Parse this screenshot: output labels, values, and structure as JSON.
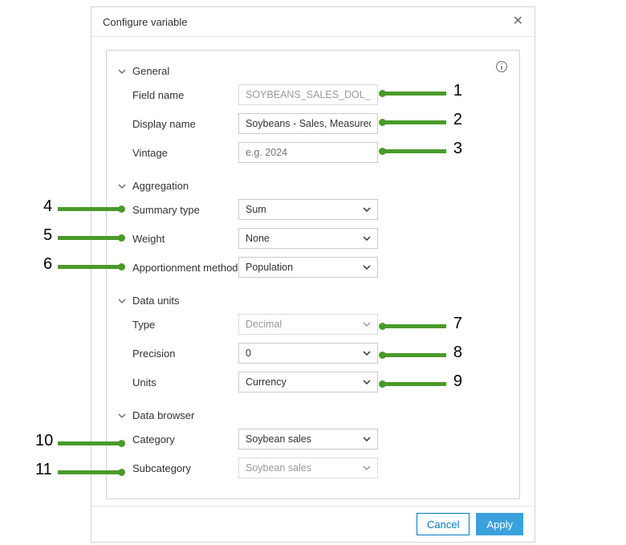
{
  "dialog": {
    "title": "Configure variable"
  },
  "sections": {
    "general": {
      "header": "General",
      "field_name_label": "Field name",
      "field_name_value": "SOYBEANS_SALES_DOL_TO",
      "display_name_label": "Display name",
      "display_name_value": "Soybeans - Sales, Measured i",
      "vintage_label": "Vintage",
      "vintage_placeholder": "e.g. 2024"
    },
    "aggregation": {
      "header": "Aggregation",
      "summary_label": "Summary type",
      "summary_value": "Sum",
      "weight_label": "Weight",
      "weight_value": "None",
      "apportion_label": "Apportionment method",
      "apportion_value": "Population"
    },
    "data_units": {
      "header": "Data units",
      "type_label": "Type",
      "type_value": "Decimal",
      "precision_label": "Precision",
      "precision_value": "0",
      "units_label": "Units",
      "units_value": "Currency"
    },
    "data_browser": {
      "header": "Data browser",
      "category_label": "Category",
      "category_value": "Soybean sales",
      "subcategory_label": "Subcategory",
      "subcategory_value": "Soybean sales"
    }
  },
  "footer": {
    "cancel_label": "Cancel",
    "apply_label": "Apply"
  },
  "callouts": {
    "n1": "1",
    "n2": "2",
    "n3": "3",
    "n4": "4",
    "n5": "5",
    "n6": "6",
    "n7": "7",
    "n8": "8",
    "n9": "9",
    "n10": "10",
    "n11": "11"
  }
}
